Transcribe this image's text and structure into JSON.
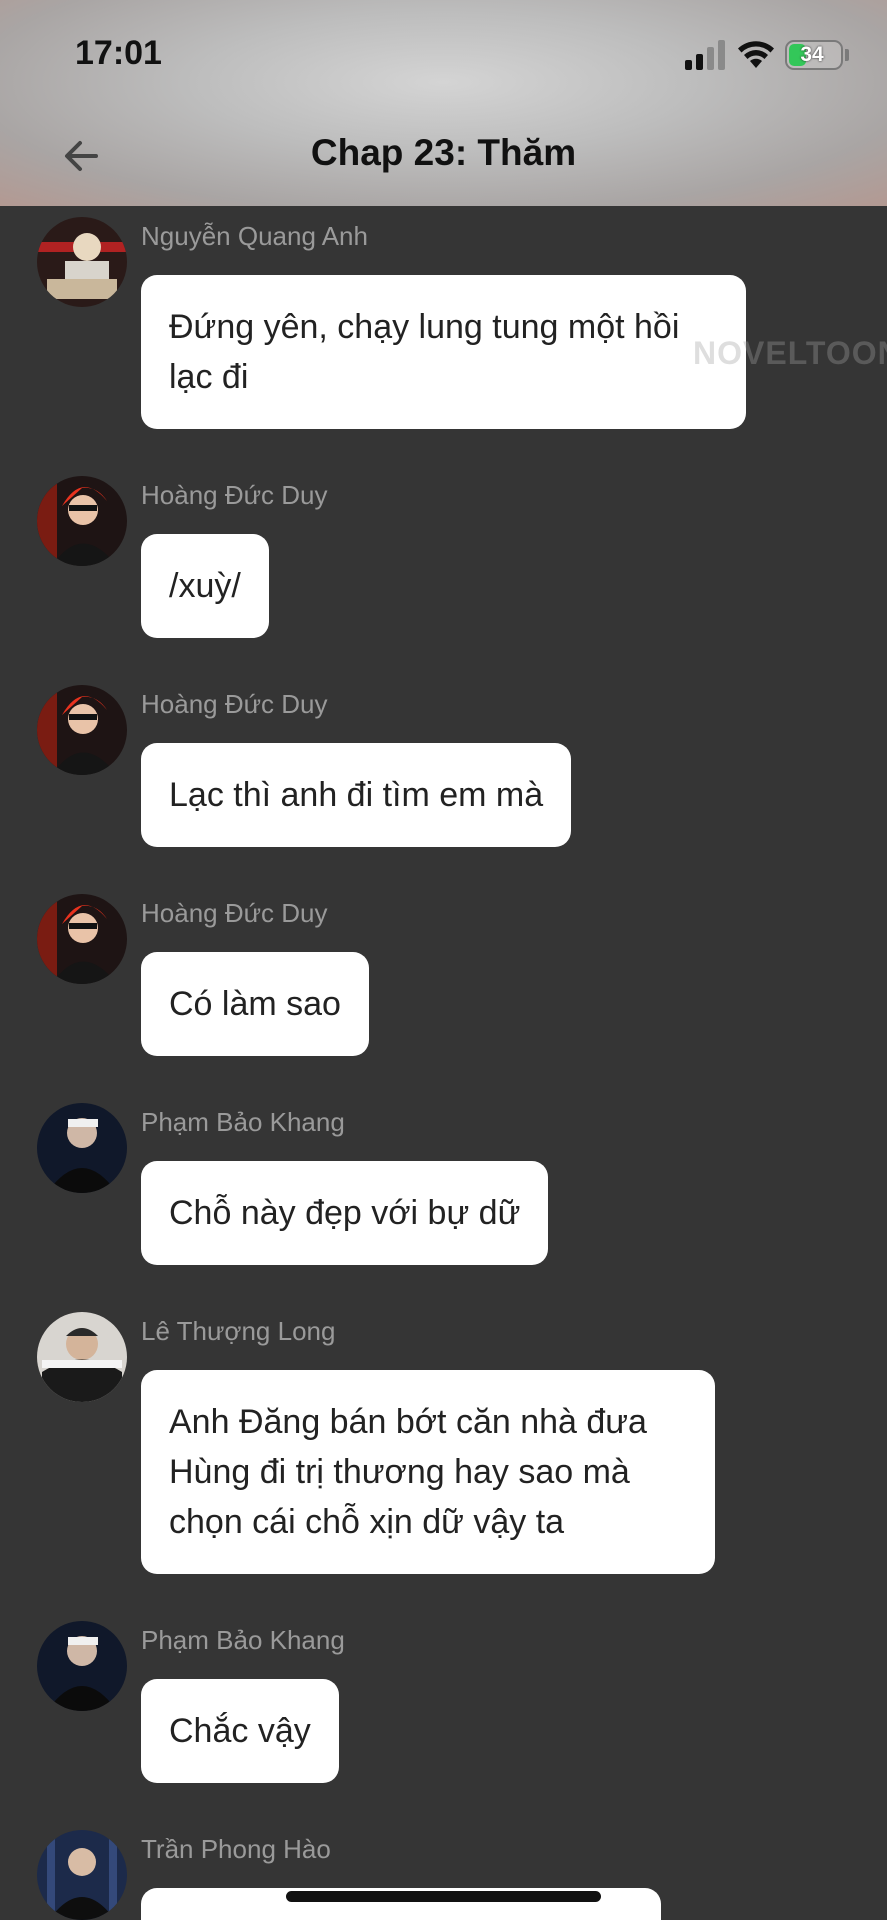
{
  "status_bar": {
    "time": "17:01",
    "battery": "34",
    "battery_color": "#33c759"
  },
  "nav": {
    "title": "Chap 23: Thăm",
    "back_icon": "arrow-left-icon"
  },
  "watermark": "NOVELTOON",
  "messages": [
    {
      "sender": "Nguyễn Quang Anh",
      "text": "Đứng yên, chạy lung tung một hồi lạc đi",
      "avatar": "avatar-photo"
    },
    {
      "sender": "Hoàng Đức Duy",
      "text": "/xuỳ/",
      "avatar": "avatar-photo"
    },
    {
      "sender": "Hoàng Đức Duy",
      "text": "Lạc thì anh đi tìm em mà",
      "avatar": "avatar-photo"
    },
    {
      "sender": "Hoàng Đức Duy",
      "text": "Có làm sao",
      "avatar": "avatar-photo"
    },
    {
      "sender": "Phạm Bảo Khang",
      "text": "Chỗ này đẹp với bự dữ",
      "avatar": "avatar-photo"
    },
    {
      "sender": "Lê Thượng Long",
      "text": "Anh Đăng bán bớt căn nhà đưa Hùng đi trị thương hay sao mà chọn cái chỗ xịn dữ vậy ta",
      "avatar": "avatar-photo"
    },
    {
      "sender": "Phạm Bảo Khang",
      "text": "Chắc vậy",
      "avatar": "avatar-photo"
    },
    {
      "sender": "Trần Phong Hào",
      "text": "",
      "avatar": "avatar-photo"
    }
  ]
}
